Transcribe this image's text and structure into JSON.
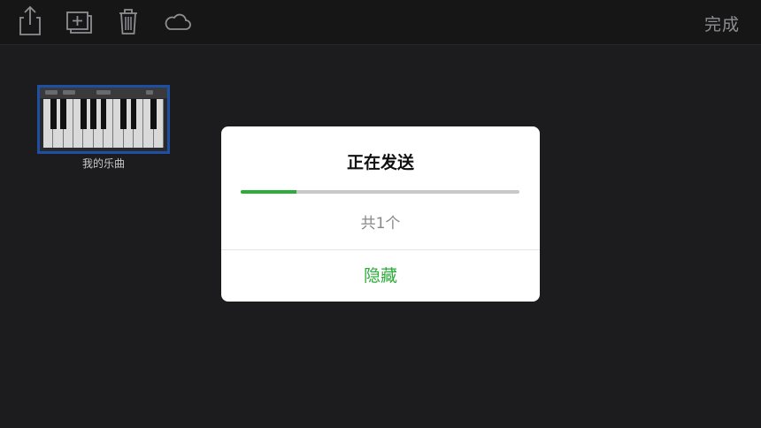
{
  "toolbar": {
    "icons": [
      "share-icon",
      "add-icon",
      "trash-icon",
      "cloud-icon"
    ],
    "done_label": "完成"
  },
  "library": {
    "songs": [
      {
        "title": "我的乐曲",
        "thumbnail": "piano-keyboard"
      }
    ]
  },
  "dialog": {
    "title": "正在发送",
    "progress": 0.2,
    "count_text": "共1个",
    "hide_label": "隐藏"
  },
  "colors": {
    "background": "#1c1c1e",
    "toolbar": "#161617",
    "accent_green": "#2dab3b",
    "selection_blue": "#1d4fa3",
    "icon_gray": "#8e8e93"
  }
}
